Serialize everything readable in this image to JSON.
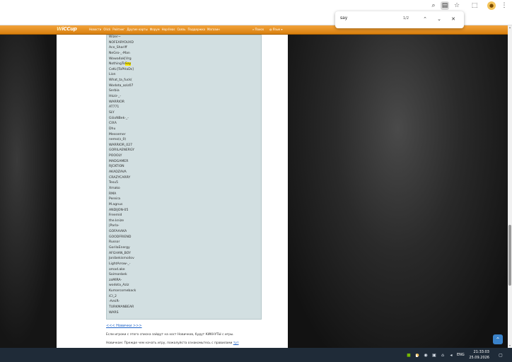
{
  "browser": {
    "icons": [
      "zoom-icon",
      "reader-icon",
      "star-icon",
      "extensions-icon",
      "menu-icon"
    ],
    "find": {
      "query": "say",
      "count": "1/2"
    }
  },
  "site": {
    "logo_prefix": "W",
    "logo_rest": "iCCup",
    "nav": [
      "Новости",
      "Olick",
      "Рейтинг",
      "Другие карты",
      "Форум",
      "Hoprileas",
      "Связь",
      "Поддержка",
      "Магазин"
    ],
    "search": "Поиск",
    "lang": "Язык"
  },
  "players": [
    "Wizer~",
    "NOFEARYOUXD",
    "Ace_Shariff",
    "NeGro-_-Man",
    "Wowa4ok[Vrg",
    "NothingToSay",
    "CeKc[ToPHaDs]",
    "Lion",
    "What_ta_fuck(",
    "Wodota_aziz07",
    "Serbia",
    "Hkzir-_-",
    "WARRIOR",
    "AT771",
    "SLY",
    "GiiioNBek-_-",
    "CIXA",
    "Dhu",
    "Messemer",
    "nemo(s_0)",
    "WARRIOR_027",
    "GORILAENERGY",
    "POOOLY",
    "MADGAMER",
    "RJCKTION",
    "AKADZAVA",
    "CRAZYCARRY",
    "Tesu5",
    "Xmako",
    "RMA",
    "Pereira",
    "M.agnus",
    "ANDIJON-05",
    "Freemid",
    "the.knize",
    "|Parla-",
    "GOFAAAKA",
    "GOODFRIEND",
    "Russor",
    "GorilaEnergy",
    "AFGHAN_BOY",
    "Jonibekismoilov",
    "LightArrow-_-",
    "omad.ake",
    "Soimonbek",
    "zaMIRA-",
    "wodota_Aziz",
    "Kumarcomeback",
    "iCl_2",
    "-AmiR-",
    "TURKMANBEAR",
    "WARS"
  ],
  "highlight": {
    "index": 5,
    "before": "NothingTo",
    "match": "Say"
  },
  "novice_link": "<<< Новички >>>",
  "para1": "Если игроки с этого списка зайдут на хост Новичков, будут КИКНУТЫ с игры.",
  "para2_text": "Новичкам: Прежде чем начать игру, пожалуйста ознакомьтесь с правилами ",
  "para2_link": "тут",
  "taskbar": {
    "lang": "ENG",
    "time": "21:33:03",
    "date": "25.09.2026"
  }
}
